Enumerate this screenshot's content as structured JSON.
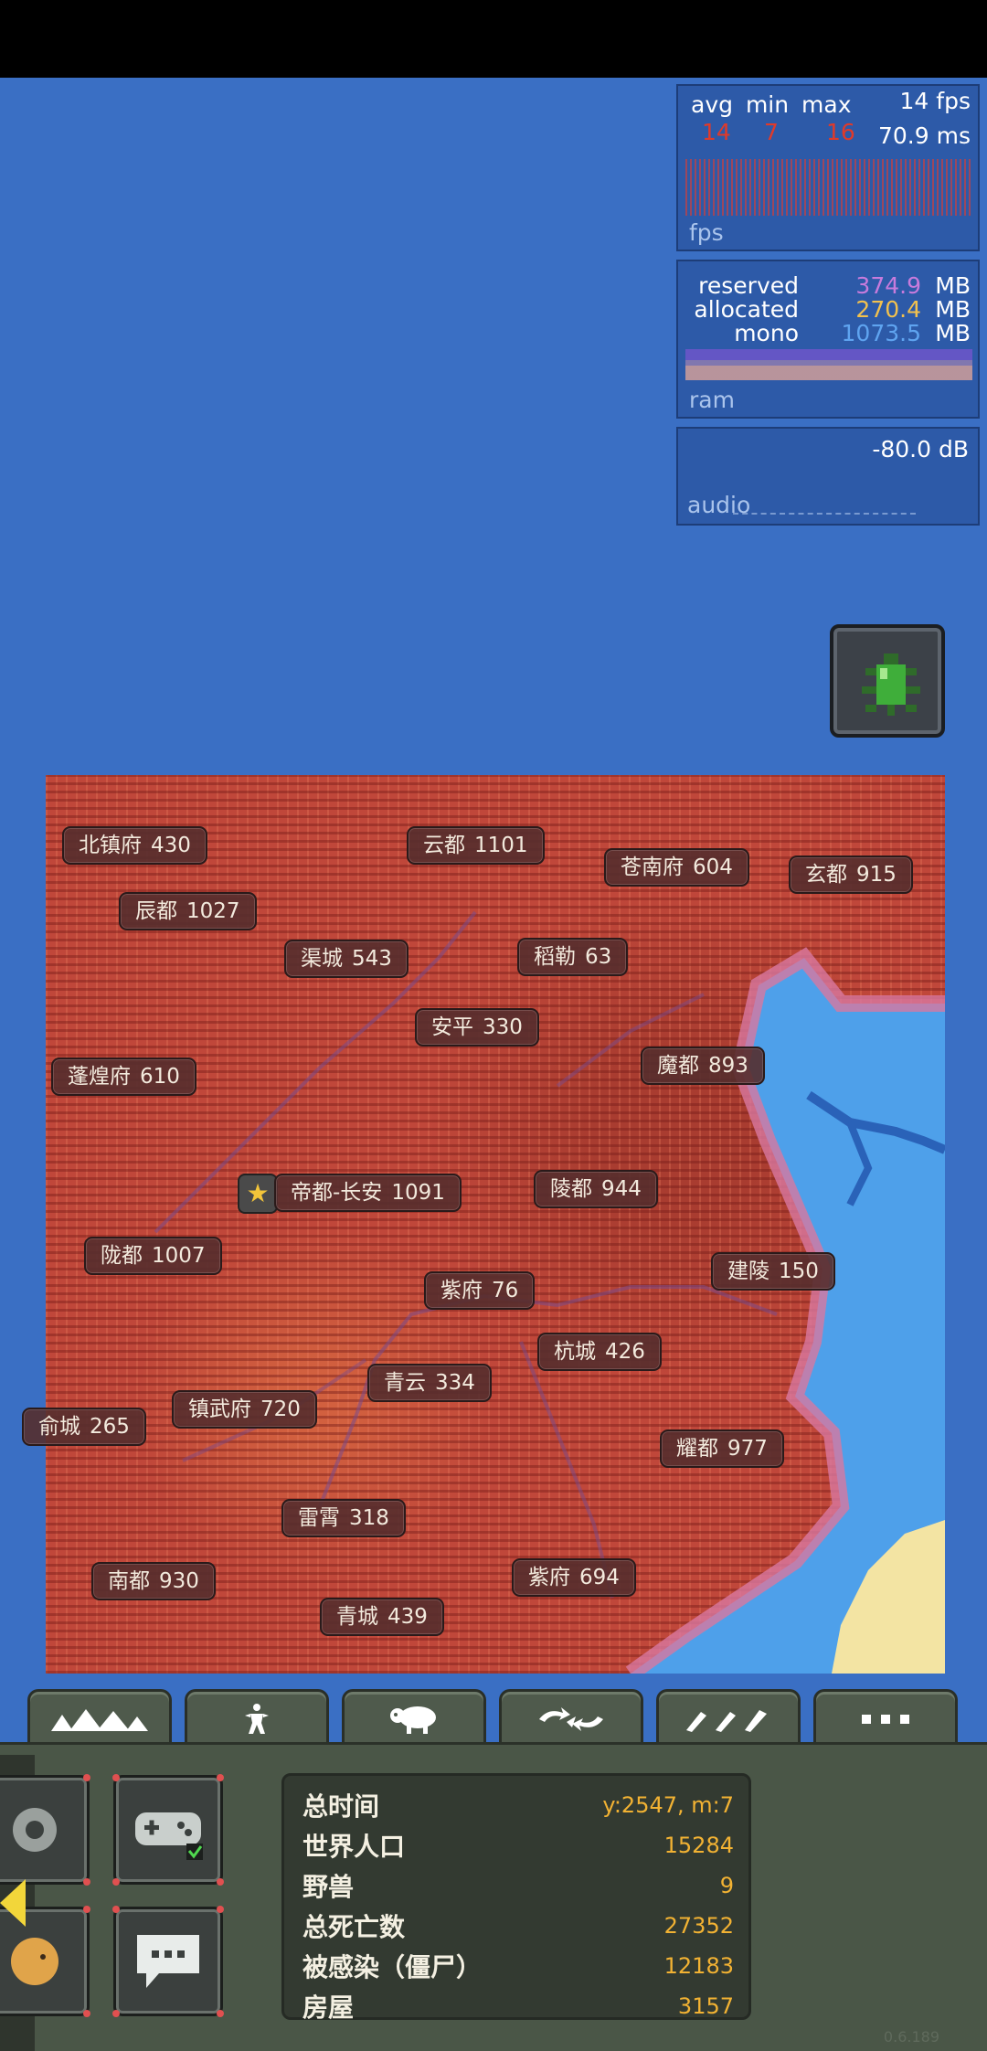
{
  "debug": {
    "fps": {
      "headers": [
        "avg",
        "min",
        "max"
      ],
      "values": [
        "14",
        "7",
        "16"
      ],
      "current": "14 fps",
      "frame_time": "70.9 ms",
      "label": "fps"
    },
    "memory": {
      "rows": [
        {
          "key": "reserved",
          "value": "374.9",
          "unit": "MB",
          "color": "#c77bdc"
        },
        {
          "key": "allocated",
          "value": "270.4",
          "unit": "MB",
          "color": "#f2c14e"
        },
        {
          "key": "mono",
          "value": "1073.5",
          "unit": "MB",
          "color": "#5fa4f0"
        }
      ],
      "label": "ram"
    },
    "audio": {
      "level": "-80.0 dB",
      "label": "audio"
    }
  },
  "power": {
    "icon": "green-beetle-icon"
  },
  "cities": [
    {
      "name": "北镇府",
      "pop": "430"
    },
    {
      "name": "云都",
      "pop": "1101"
    },
    {
      "name": "苍南府",
      "pop": "604"
    },
    {
      "name": "玄都",
      "pop": "915"
    },
    {
      "name": "辰都",
      "pop": "1027"
    },
    {
      "name": "渠城",
      "pop": "543"
    },
    {
      "name": "稻勒",
      "pop": "63"
    },
    {
      "name": "安平",
      "pop": "330"
    },
    {
      "name": "魔都",
      "pop": "893"
    },
    {
      "name": "蓬煌府",
      "pop": "610"
    },
    {
      "name": "帝都-长安",
      "pop": "1091"
    },
    {
      "name": "陵都",
      "pop": "944"
    },
    {
      "name": "陇都",
      "pop": "1007"
    },
    {
      "name": "建陵",
      "pop": "150"
    },
    {
      "name": "紫府",
      "pop": "76"
    },
    {
      "name": "杭城",
      "pop": "426"
    },
    {
      "name": "青云",
      "pop": "334"
    },
    {
      "name": "镇武府",
      "pop": "720"
    },
    {
      "name": "俞城",
      "pop": "265"
    },
    {
      "name": "耀都",
      "pop": "977"
    },
    {
      "name": "雷霄",
      "pop": "318"
    },
    {
      "name": "南都",
      "pop": "930"
    },
    {
      "name": "紫府",
      "pop": "694"
    },
    {
      "name": "青城",
      "pop": "439"
    }
  ],
  "tabs": [
    "terrain-mountains-icon",
    "creatures-person-icon",
    "animals-sheep-icon",
    "nature-cycle-icon",
    "tools-brushes-icon",
    "more-dots-icon"
  ],
  "panel_buttons": [
    "settings-gear-icon",
    "gamepad-icon",
    "emoji-face-icon",
    "chat-bubble-icon"
  ],
  "stats": [
    {
      "key": "总时间",
      "value": "y:2547, m:7"
    },
    {
      "key": "世界人口",
      "value": "15284"
    },
    {
      "key": "野兽",
      "value": "9"
    },
    {
      "key": "总死亡数",
      "value": "27352"
    },
    {
      "key": "被感染（僵尸）",
      "value": "12183"
    },
    {
      "key": "房屋",
      "value": "3157"
    }
  ],
  "version": "0.6.189"
}
